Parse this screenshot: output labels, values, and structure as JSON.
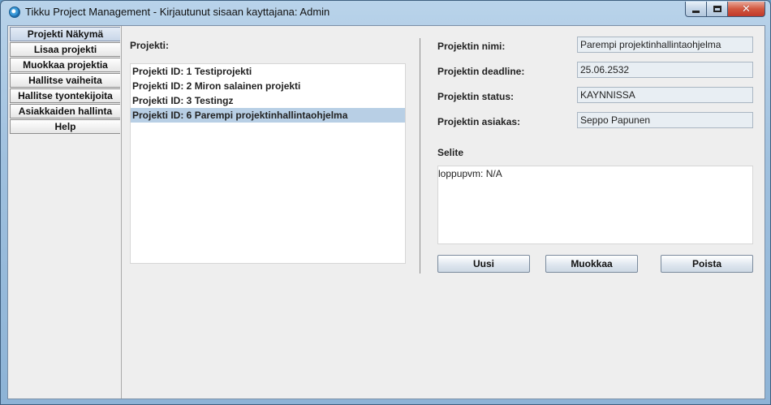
{
  "window": {
    "title": "Tikku Project Management - Kirjautunut sisaan kayttajana: Admin",
    "close_glyph": "✕"
  },
  "tabs": [
    {
      "label": "Projekti Näkymä",
      "active": true
    },
    {
      "label": "Lisaa projekti",
      "active": false
    },
    {
      "label": "Muokkaa projektia",
      "active": false
    },
    {
      "label": "Hallitse vaiheita",
      "active": false
    },
    {
      "label": "Hallitse tyontekijoita",
      "active": false
    },
    {
      "label": "Asiakkaiden hallinta",
      "active": false
    },
    {
      "label": "Help",
      "active": false
    }
  ],
  "projects": {
    "heading": "Projekti:",
    "items": [
      "Projekti ID: 1 Testiprojekti",
      "Projekti ID: 2 Miron salainen projekti",
      "Projekti ID: 3 Testingz",
      "Projekti ID: 6 Parempi projektinhallintaohjelma"
    ],
    "selected_index": 3
  },
  "details": {
    "name_label": "Projektin nimi:",
    "name_value": "Parempi projektinhallintaohjelma",
    "deadline_label": "Projektin deadline:",
    "deadline_value": "25.06.2532",
    "status_label": "Projektin status:",
    "status_value": "KAYNNISSA",
    "client_label": "Projektin asiakas:",
    "client_value": "Seppo Papunen",
    "description_label": "Selite",
    "description_value": "loppupvm: N/A"
  },
  "buttons": {
    "new": "Uusi",
    "edit": "Muokkaa",
    "delete": "Poista"
  },
  "colors": {
    "selected_row": "#b8cfe5",
    "close_button": "#c0392b"
  }
}
